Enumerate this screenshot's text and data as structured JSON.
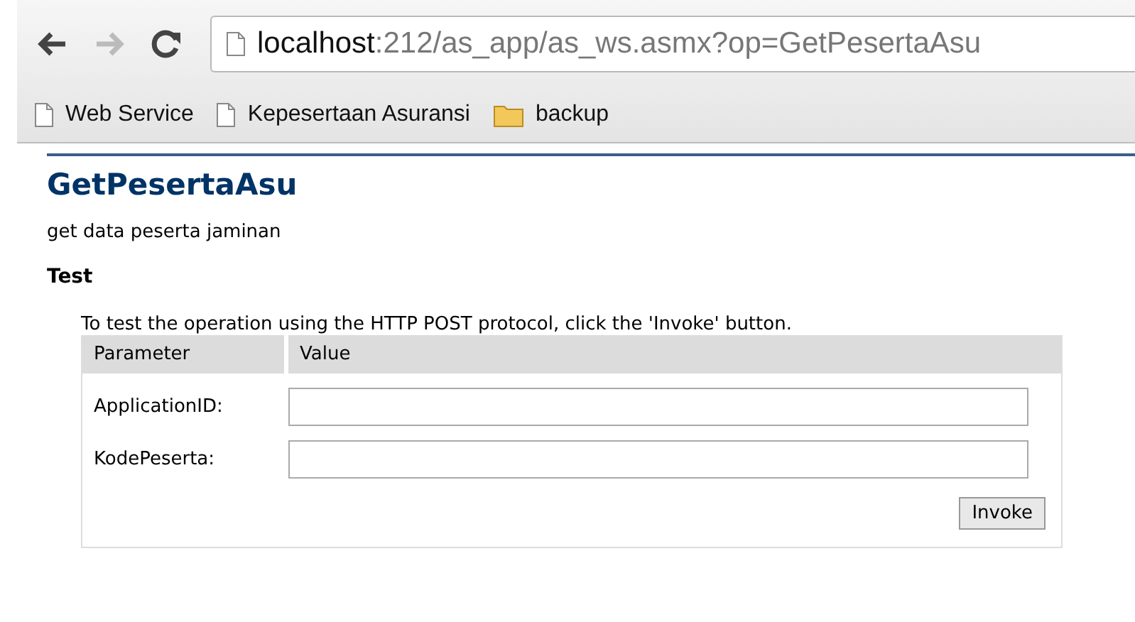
{
  "address_bar": {
    "host": "localhost",
    "path": ":212/as_app/as_ws.asmx?op=GetPesertaAsu"
  },
  "bookmarks": [
    {
      "kind": "page",
      "label": "Web Service"
    },
    {
      "kind": "page",
      "label": "Kepesertaan Asuransi"
    },
    {
      "kind": "folder",
      "label": "backup"
    }
  ],
  "page": {
    "title": "GetPesertaAsu",
    "description": "get data peserta jaminan",
    "section": "Test",
    "instructions": "To test the operation using the HTTP POST protocol, click the 'Invoke' button.",
    "table": {
      "columns": [
        "Parameter",
        "Value"
      ],
      "rows": [
        {
          "label": "ApplicationID:"
        },
        {
          "label": "KodePeserta:"
        }
      ],
      "button": "Invoke"
    }
  }
}
